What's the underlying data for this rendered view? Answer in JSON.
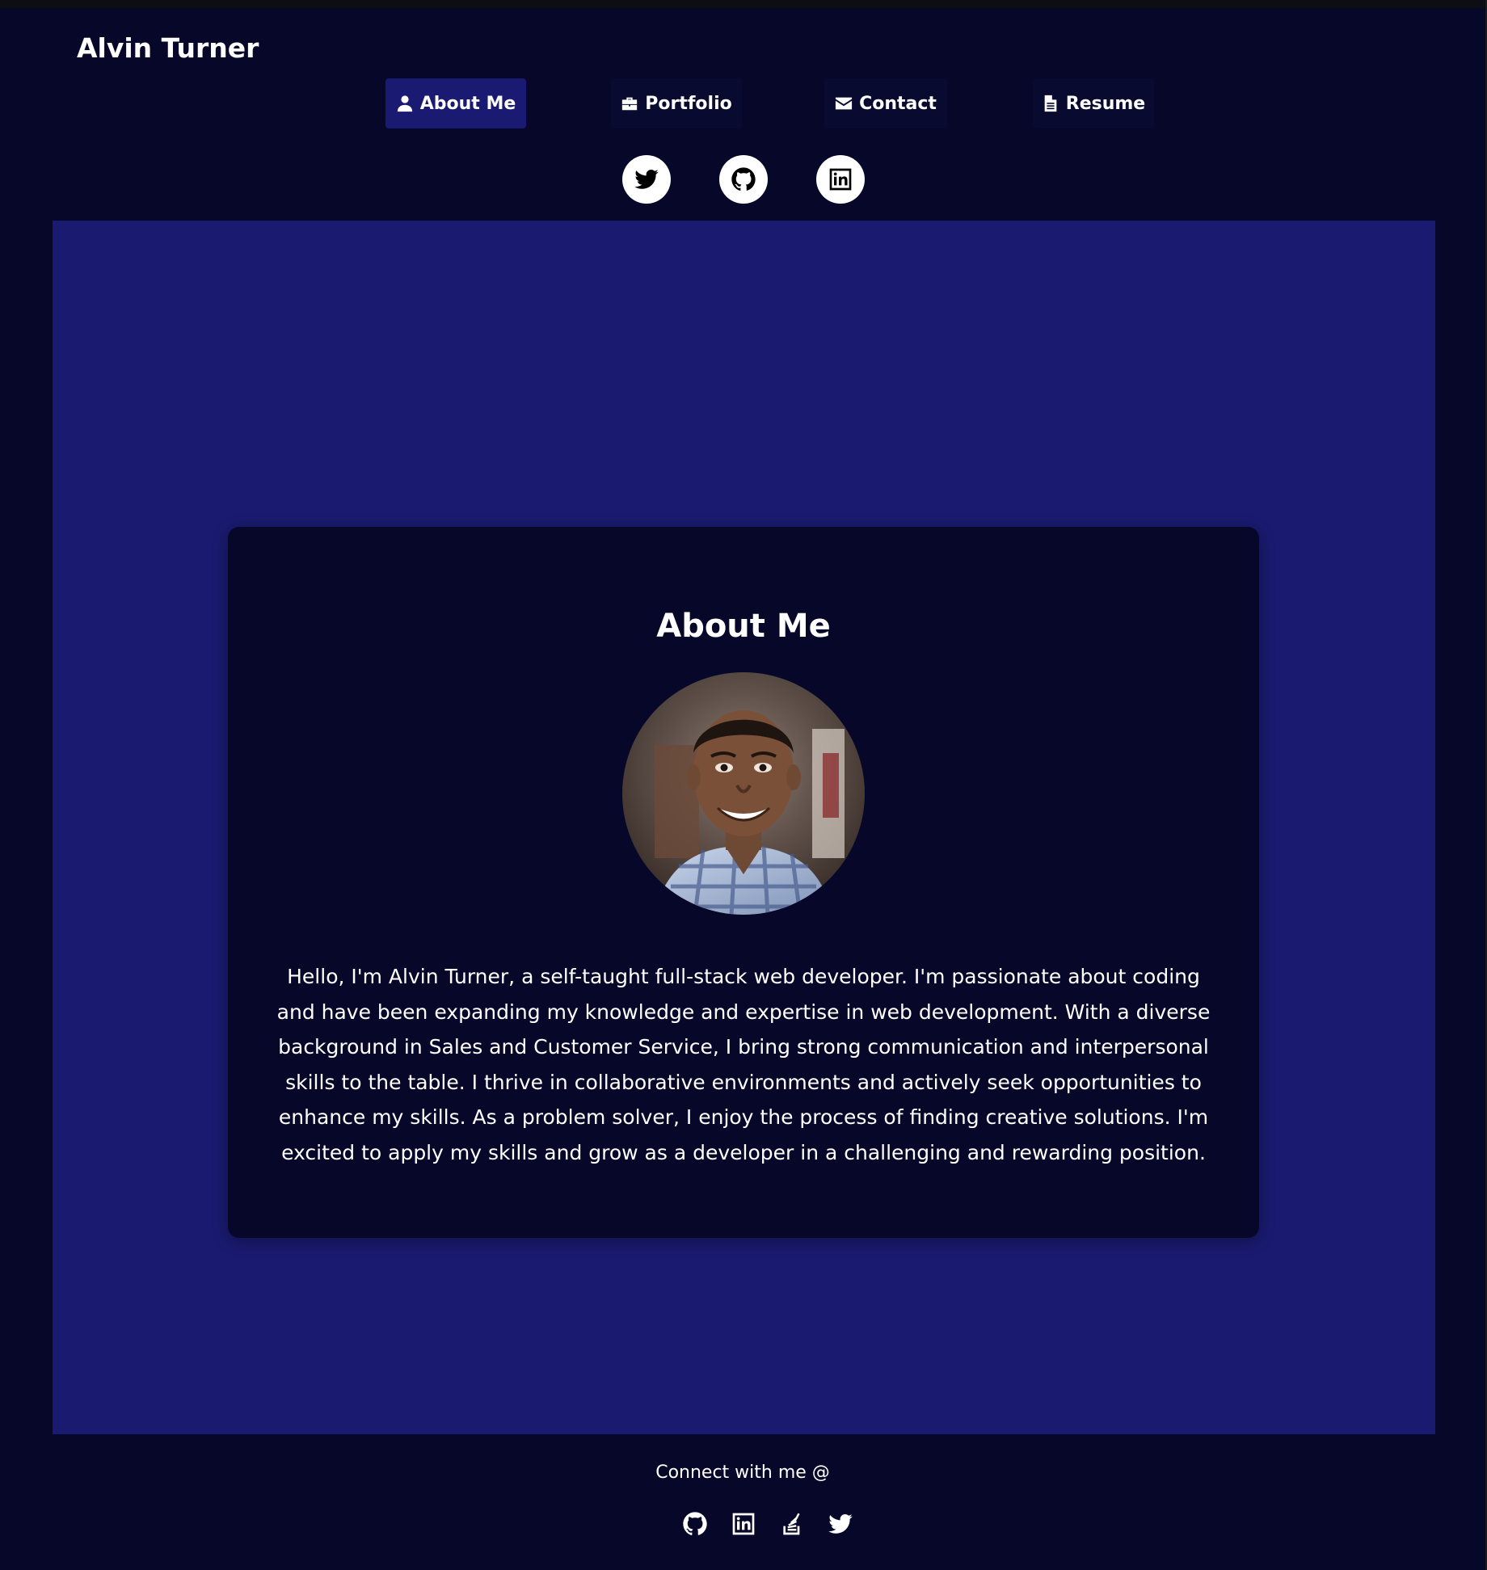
{
  "brand": {
    "name": "Alvin Turner"
  },
  "nav": {
    "items": [
      {
        "label": "About Me",
        "icon": "user-icon",
        "active": true
      },
      {
        "label": "Portfolio",
        "icon": "briefcase-icon",
        "active": false
      },
      {
        "label": "Contact",
        "icon": "envelope-icon",
        "active": false
      },
      {
        "label": "Resume",
        "icon": "document-icon",
        "active": false
      }
    ]
  },
  "header_socials": [
    {
      "icon": "twitter-icon"
    },
    {
      "icon": "github-icon"
    },
    {
      "icon": "linkedin-icon"
    }
  ],
  "about": {
    "title": "About Me",
    "photo_icon": "profile-photo",
    "bio": "Hello, I'm Alvin Turner, a self-taught full-stack web developer. I'm passionate about coding and have been expanding my knowledge and expertise in web development. With a diverse background in Sales and Customer Service, I bring strong communication and interpersonal skills to the table. I thrive in collaborative environments and actively seek opportunities to enhance my skills. As a problem solver, I enjoy the process of finding creative solutions. I'm excited to apply my skills and grow as a developer in a challenging and rewarding position."
  },
  "footer": {
    "text": "Connect with me @",
    "icons": [
      {
        "icon": "github-icon"
      },
      {
        "icon": "linkedin-icon"
      },
      {
        "icon": "stackoverflow-icon"
      },
      {
        "icon": "twitter-icon"
      }
    ]
  },
  "colors": {
    "page_bg": "#070829",
    "main_bg": "#1a1a70",
    "active_nav": "#1a1a73",
    "card_bg": "#070829"
  }
}
